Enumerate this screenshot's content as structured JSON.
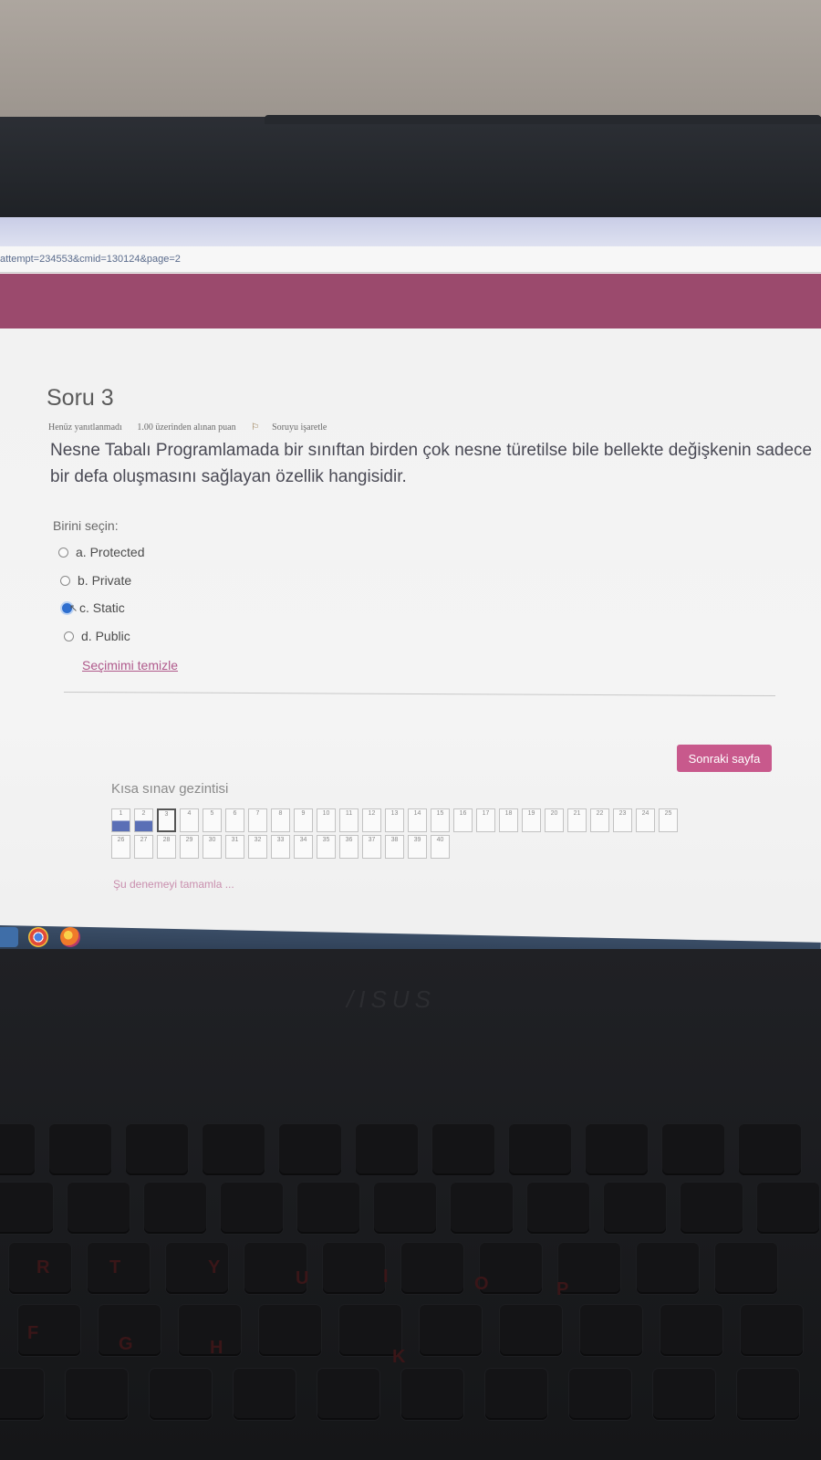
{
  "browser": {
    "url": "attempt=234553&cmid=130124&page=2"
  },
  "question": {
    "title": "Soru 3",
    "status": "Henüz yanıtlanmadı",
    "marks": "1.00 üzerinden alınan puan",
    "flag_label": "Soruyu işaretle",
    "text": "Nesne Tabalı Programlamada bir sınıftan birden çok nesne türetilse bile bellekte değişkenin sadece bir defa oluşmasını sağlayan özellik hangisidir.",
    "choose_label": "Birini seçin:",
    "options": [
      {
        "label": "a. Protected",
        "selected": false
      },
      {
        "label": "b. Private",
        "selected": false
      },
      {
        "label": "c. Static",
        "selected": true
      },
      {
        "label": "d. Public",
        "selected": false
      }
    ],
    "clear_label": "Seçimimi temizle"
  },
  "next_button": "Sonraki sayfa",
  "quiz_nav": {
    "title": "Kısa sınav gezintisi",
    "row1": [
      "1",
      "2",
      "3",
      "4",
      "5",
      "6",
      "7",
      "8",
      "9",
      "10",
      "11",
      "12",
      "13",
      "14",
      "15",
      "16",
      "17",
      "18",
      "19",
      "20",
      "21",
      "22",
      "23",
      "24",
      "25"
    ],
    "row2": [
      "26",
      "27",
      "28",
      "29",
      "30",
      "31",
      "32",
      "33",
      "34",
      "35",
      "36",
      "37",
      "38",
      "39",
      "40"
    ],
    "answered": [
      "1",
      "2"
    ],
    "current": "3",
    "finish_label": "Şu denemeyi tamamla ..."
  },
  "colors": {
    "header": "#9b4a6d",
    "button": "#c8598c",
    "answered": "#5a6fb6"
  },
  "keyboard": {
    "glyphs": [
      "R",
      "T",
      "Y",
      "U",
      "I",
      "O",
      "P",
      "F",
      "G",
      "H",
      "K"
    ]
  }
}
